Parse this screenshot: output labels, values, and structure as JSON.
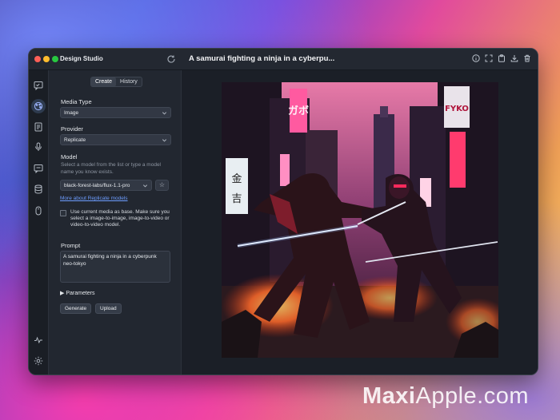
{
  "app": {
    "title": "Design Studio",
    "document_title": "A samurai fighting a ninja in a cyberpu..."
  },
  "tabs": {
    "create": "Create",
    "history": "History"
  },
  "form": {
    "media_type_label": "Media Type",
    "media_type_value": "Image",
    "provider_label": "Provider",
    "provider_value": "Replicate",
    "model_label": "Model",
    "model_help": "Select a model from the list or type a model name you know exists.",
    "model_value": "black-forest-labs/flux-1.1-pro",
    "more_link": "More about Replicate models",
    "checkbox_text": "Use current media as base. Make sure you select a image-to-image, image-to-video or video-to-video model.",
    "prompt_label": "Prompt",
    "prompt_value": "A samurai fighting a ninja in a cyberpunk neo-tokyo",
    "parameters_label": "▶ Parameters",
    "generate_label": "Generate",
    "upload_label": "Upload"
  },
  "icons": {
    "rail": [
      "chat-icon",
      "palette-icon",
      "document-icon",
      "microphone-icon",
      "message-icon",
      "database-icon",
      "mouse-icon",
      "activity-icon",
      "settings-icon"
    ],
    "toolbar": [
      "info-icon",
      "fullscreen-icon",
      "copy-icon",
      "download-icon",
      "trash-icon"
    ]
  },
  "artwork_signs": [
    "ガボ",
    "金",
    "吉",
    "FYKO"
  ],
  "watermark": {
    "bold": "Maxi",
    "regular": "Apple.com"
  },
  "colors": {
    "accent": "#6d9dff",
    "window_bg": "#1e232c"
  }
}
